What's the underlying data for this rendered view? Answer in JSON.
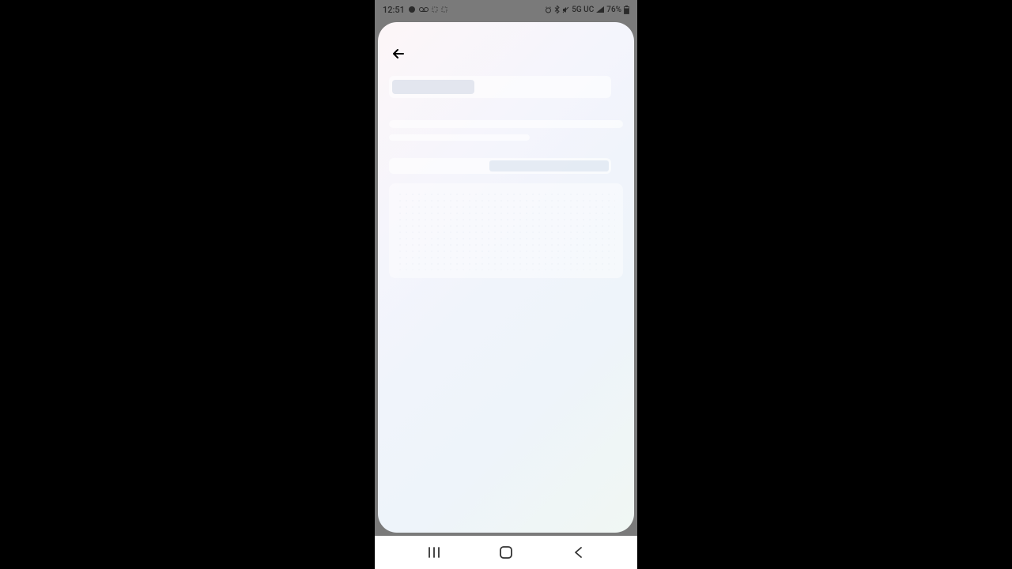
{
  "status_bar": {
    "time": "12:51",
    "network_type": "5G UC",
    "battery_percent": "76%"
  },
  "app": {
    "loading": true
  },
  "nav": {
    "recents": "|||",
    "home": "○",
    "back": "‹"
  }
}
